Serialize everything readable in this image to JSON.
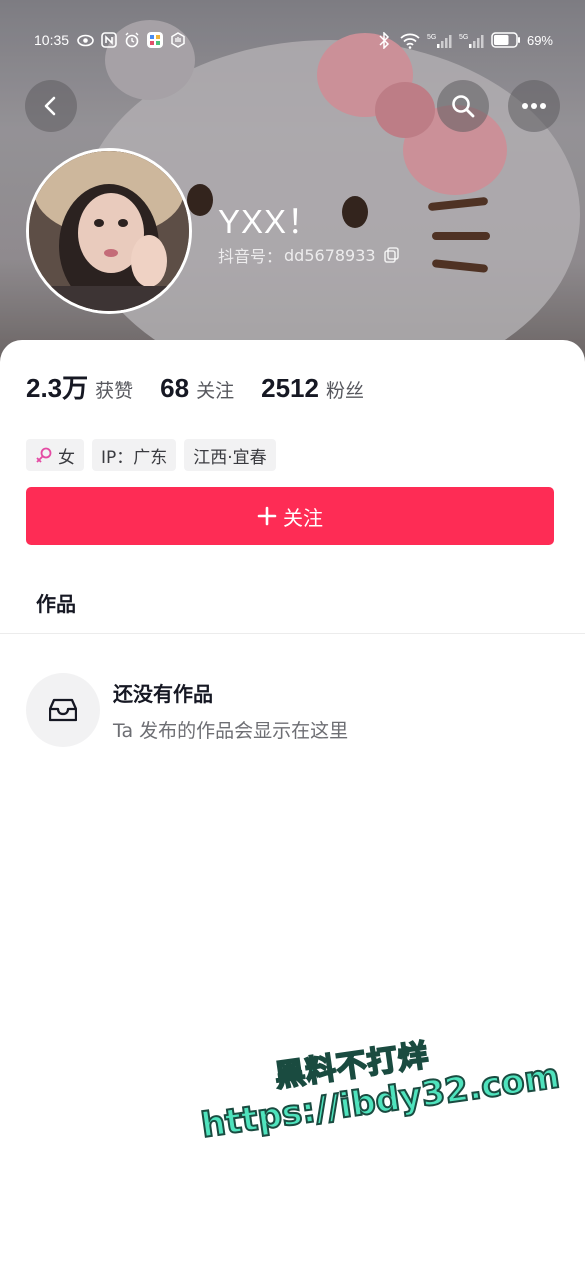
{
  "status_bar": {
    "time": "10:35",
    "battery_percent": "69%",
    "network_1": "5G",
    "network_2": "5G",
    "battery_level": 0.69
  },
  "profile": {
    "nickname": "YXX！",
    "douyin_id_label": "抖音号：",
    "douyin_id": "dd5678933"
  },
  "stats": [
    {
      "num": "2.3万",
      "label": "获赞"
    },
    {
      "num": "68",
      "label": "关注"
    },
    {
      "num": "2512",
      "label": "粉丝"
    }
  ],
  "tags": {
    "gender": "女",
    "ip": "IP：广东",
    "location": "江西·宜春"
  },
  "follow_button": {
    "label": "关注"
  },
  "tabs": {
    "works": "作品"
  },
  "empty_state": {
    "title": "还没有作品",
    "subtitle": "Ta 发布的作品会显示在这里"
  },
  "watermark": {
    "line1": "黑料不打烊",
    "line2": "https://ibdy32.com"
  },
  "colors": {
    "accent": "#fe2c55",
    "female_icon": "#e44ba3",
    "watermark": "#4fe3bd"
  },
  "icons": [
    "back-icon",
    "search-icon",
    "more-icon",
    "copy-icon",
    "female-icon",
    "plus-icon",
    "inbox-icon"
  ]
}
